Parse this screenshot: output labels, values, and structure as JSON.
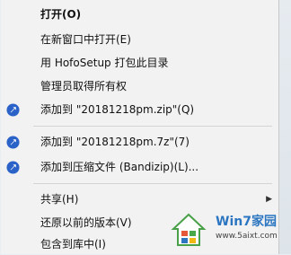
{
  "context_menu": {
    "items": [
      {
        "label": "打开(O)"
      },
      {
        "label": "在新窗口中打开(E)"
      },
      {
        "label": "用 HofoSetup 打包此目录"
      },
      {
        "label": "管理员取得所有权"
      },
      {
        "label": "添加到 \"20181218pm.zip\"(Q)"
      },
      {
        "label": "添加到 \"20181218pm.7z\"(7)"
      },
      {
        "label": "添加到压缩文件 (Bandizip)(L)..."
      },
      {
        "label": "共享(H)"
      },
      {
        "label": "还原以前的版本(V)"
      },
      {
        "label": "包含到库中(I)"
      }
    ],
    "accent_color": "#2a62c8"
  },
  "watermark": {
    "title": "Win7家园",
    "url": "www.5aixt.com"
  }
}
